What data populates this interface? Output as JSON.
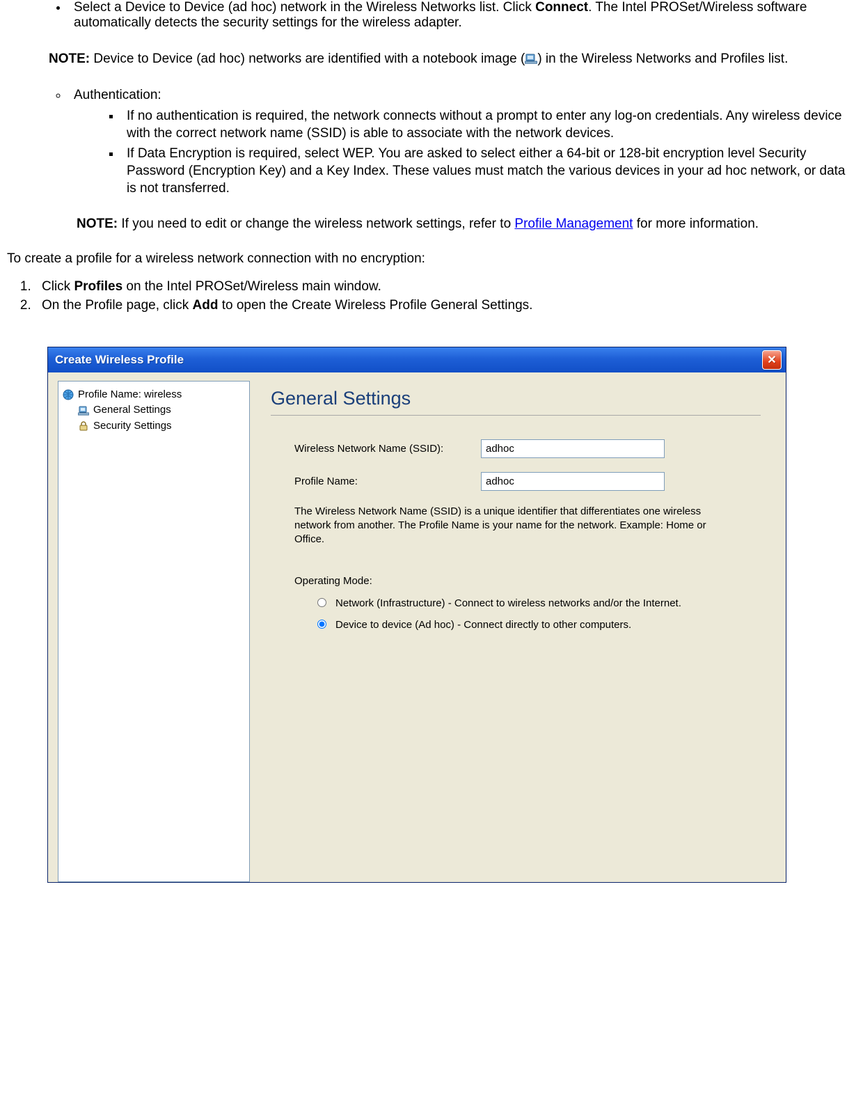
{
  "doc": {
    "bullet_intro_a": "Select a Device to Device (ad hoc) network in the Wireless Networks list. Click ",
    "bullet_intro_bold": "Connect",
    "bullet_intro_b": ". The Intel PROSet/Wireless software automatically detects the security settings for the wireless adapter.",
    "note1_label": "NOTE:",
    "note1_text": " Device to Device (ad hoc) networks are identified with a notebook image (",
    "note1_text2": ") in the Wireless Networks and Profiles list.",
    "auth_label": "Authentication:",
    "auth_item1": "If no authentication is required, the network connects without a prompt to enter any log-on credentials. Any wireless device with the correct network name (SSID) is able to associate with the network devices.",
    "auth_item2": "If Data Encryption is required, select WEP. You are asked to select either a 64-bit or 128-bit encryption level Security Password (Encryption Key) and a Key Index. These values must match the various devices in your ad hoc network, or data is not transferred.",
    "note2_label": "NOTE:",
    "note2_a": " If you need to edit or change the wireless network settings, refer to ",
    "note2_link": "Profile Management",
    "note2_b": " for more information.",
    "intro": "To create a profile for a wireless network connection with no encryption:",
    "step1_a": "Click ",
    "step1_bold": "Profiles",
    "step1_b": " on the Intel PROSet/Wireless main window.",
    "step2_a": "On the Profile page, click ",
    "step2_bold": "Add",
    "step2_b": " to open the Create Wireless Profile General Settings."
  },
  "dialog": {
    "title": "Create Wireless Profile",
    "sidebar": {
      "profile_label": "Profile Name: wireless",
      "general": "General Settings",
      "security": "Security Settings"
    },
    "content_title": "General Settings",
    "ssid_label": "Wireless Network Name (SSID):",
    "ssid_value": "adhoc",
    "profile_label": "Profile Name:",
    "profile_value": "adhoc",
    "desc": "The Wireless Network Name (SSID) is a unique identifier that differentiates one wireless network from another. The Profile Name is your name for the network. Example: Home or Office.",
    "opmode_label": "Operating Mode:",
    "radio_infra": "Network (Infrastructure) - Connect to wireless networks and/or the Internet.",
    "radio_adhoc": "Device to device (Ad hoc) - Connect directly to other computers."
  }
}
